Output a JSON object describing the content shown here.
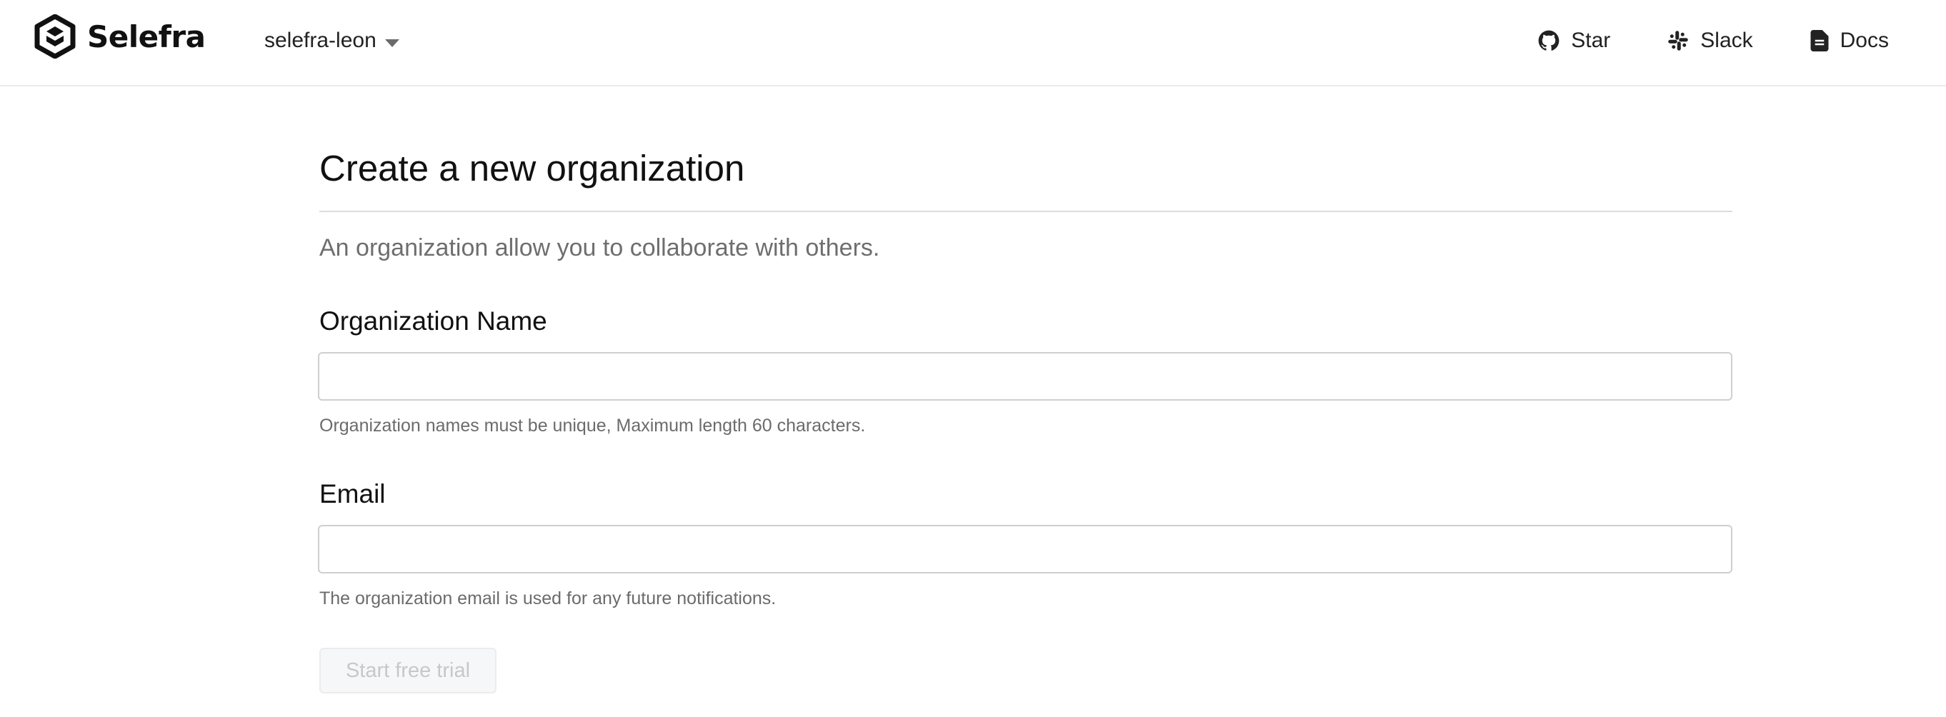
{
  "header": {
    "brand": "Selefra",
    "org_switcher": {
      "label": "selefra-leon",
      "icon": "chevron-down-icon"
    },
    "links": [
      {
        "label": "Star",
        "icon": "github-icon"
      },
      {
        "label": "Slack",
        "icon": "slack-icon"
      },
      {
        "label": "Docs",
        "icon": "docs-icon"
      }
    ]
  },
  "main": {
    "title": "Create a new organization",
    "subtitle": "An organization allow you to collaborate with others.",
    "fields": {
      "name": {
        "label": "Organization Name",
        "value": "",
        "placeholder": "",
        "help": "Organization names must be unique, Maximum length 60 characters."
      },
      "email": {
        "label": "Email",
        "value": "",
        "placeholder": "",
        "help": "The organization email is used for any future notifications."
      }
    },
    "submit_label": "Start free trial",
    "submit_enabled": false
  },
  "colors": {
    "text": "#111111",
    "muted": "#6e6e6e",
    "border": "#cfcfcf",
    "disabled_bg": "#f6f7f8",
    "disabled_text": "#c8c8c8"
  }
}
